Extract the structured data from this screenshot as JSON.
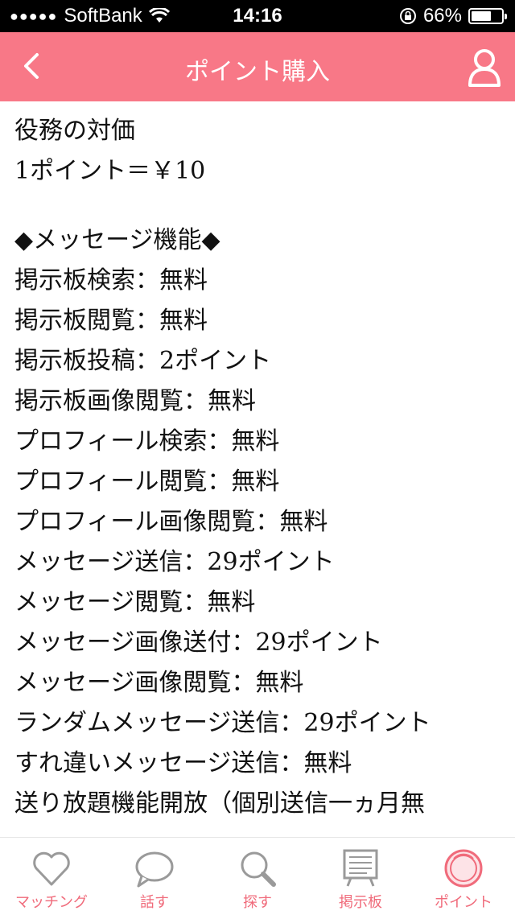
{
  "status": {
    "carrier": "SoftBank",
    "time": "14:16",
    "battery": "66%",
    "battery_level": 0.66
  },
  "header": {
    "title": "ポイント購入"
  },
  "content": {
    "lines": [
      "役務の対価",
      "1ポイント＝￥10",
      "",
      "◆メッセージ機能◆",
      "掲示板検索：無料",
      "掲示板閲覧：無料",
      "掲示板投稿：2ポイント",
      "掲示板画像閲覧：無料",
      "プロフィール検索：無料",
      "プロフィール閲覧：無料",
      "プロフィール画像閲覧：無料",
      "メッセージ送信：29ポイント",
      "メッセージ閲覧：無料",
      "メッセージ画像送付：29ポイント",
      "メッセージ画像閲覧：無料",
      "ランダムメッセージ送信：29ポイント",
      "すれ違いメッセージ送信：無料",
      "送り放題機能開放（個別送信一ヵ月無"
    ]
  },
  "tabs": [
    {
      "label": "マッチング",
      "icon": "heart-icon"
    },
    {
      "label": "話す",
      "icon": "speech-bubble-icon"
    },
    {
      "label": "探す",
      "icon": "magnifier-icon"
    },
    {
      "label": "掲示板",
      "icon": "board-icon"
    },
    {
      "label": "ポイント",
      "icon": "coin-icon"
    }
  ],
  "colors": {
    "accent": "#f87887",
    "tab_label": "#f06b7b",
    "tab_icon_inactive": "#9a9a9a"
  }
}
